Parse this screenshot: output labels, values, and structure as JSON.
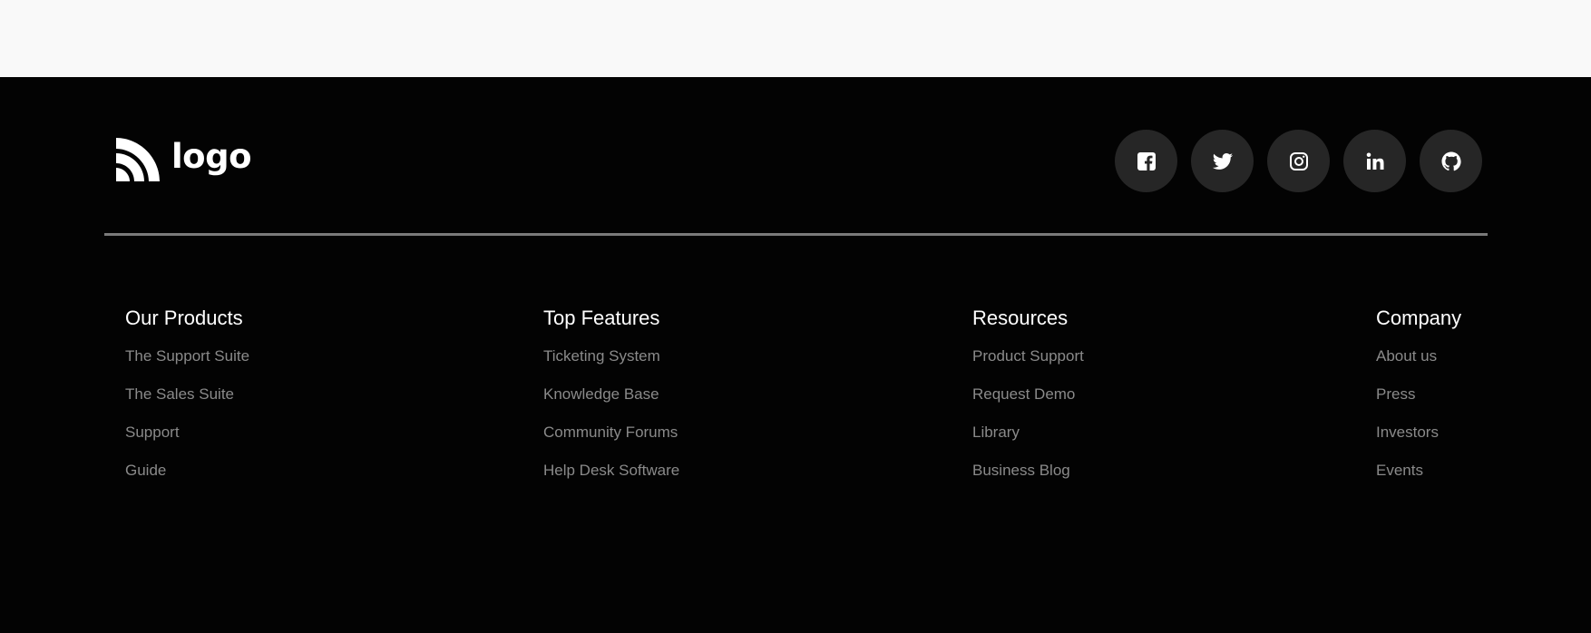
{
  "logo": {
    "text": "logo",
    "icon": "rss-logo-icon"
  },
  "social": [
    {
      "name": "facebook",
      "icon": "facebook-icon"
    },
    {
      "name": "twitter",
      "icon": "twitter-icon"
    },
    {
      "name": "instagram",
      "icon": "instagram-icon"
    },
    {
      "name": "linkedin",
      "icon": "linkedin-icon"
    },
    {
      "name": "github",
      "icon": "github-icon"
    }
  ],
  "columns": [
    {
      "title": "Our Products",
      "links": [
        "The Support Suite",
        "The Sales Suite",
        "Support",
        "Guide"
      ]
    },
    {
      "title": "Top Features",
      "links": [
        "Ticketing System",
        "Knowledge Base",
        "Community Forums",
        "Help Desk Software"
      ]
    },
    {
      "title": "Resources",
      "links": [
        "Product Support",
        "Request Demo",
        "Library",
        "Business Blog"
      ]
    },
    {
      "title": "Company",
      "links": [
        "About us",
        "Press",
        "Investors",
        "Events"
      ]
    }
  ],
  "colors": {
    "footer_bg": "#030303",
    "page_bg": "#f9f9f9",
    "social_bg": "#262626",
    "link": "#8a8a8a",
    "heading": "#ffffff"
  }
}
